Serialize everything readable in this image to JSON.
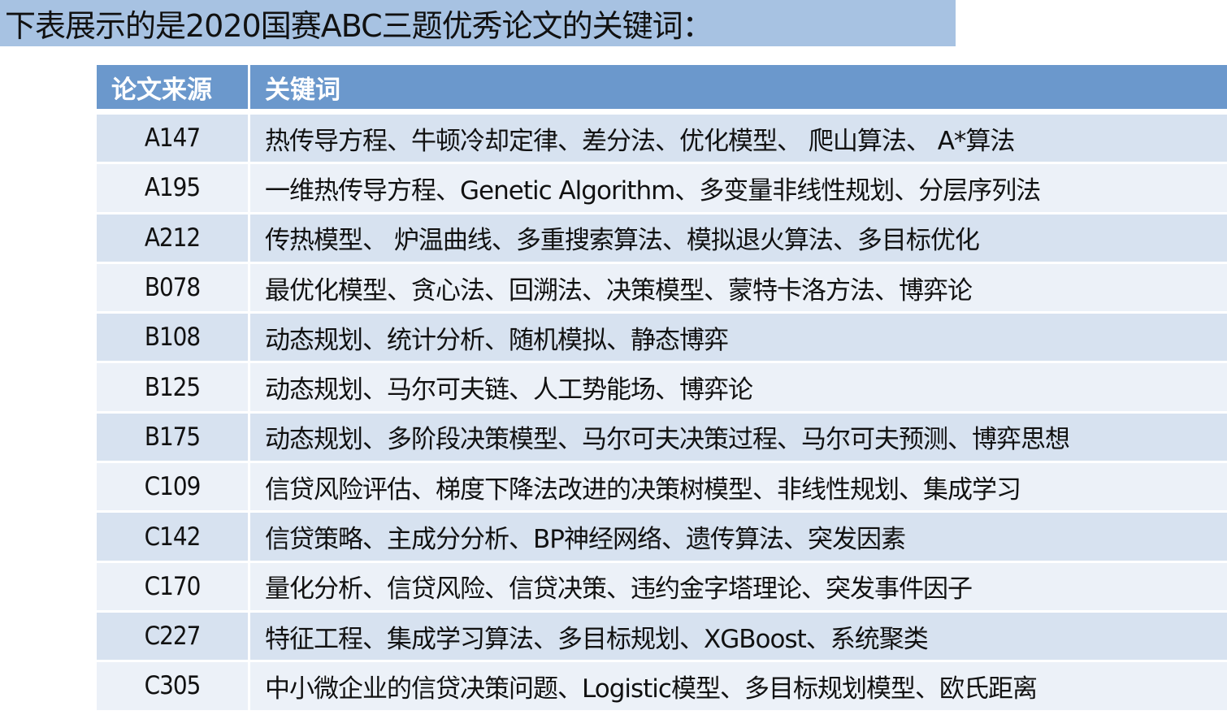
{
  "title": "下表展示的是2020国赛ABC三题优秀论文的关键词：",
  "table": {
    "headers": [
      "论文来源",
      "关键词"
    ],
    "rows": [
      [
        "A147",
        "热传导方程、牛顿冷却定律、差分法、优化模型、 爬山算法、 A*算法"
      ],
      [
        "A195",
        "一维热传导方程、Genetic Algorithm、多变量非线性规划、分层序列法"
      ],
      [
        "A212",
        "传热模型、 炉温曲线、多重搜索算法、模拟退火算法、多目标优化"
      ],
      [
        "B078",
        "最优化模型、贪心法、回溯法、决策模型、蒙特卡洛方法、博弈论"
      ],
      [
        "B108",
        "动态规划、统计分析、随机模拟、静态博弈"
      ],
      [
        "B125",
        "动态规划、马尔可夫链、人工势能场、博弈论"
      ],
      [
        "B175",
        "动态规划、多阶段决策模型、马尔可夫决策过程、马尔可夫预测、博弈思想"
      ],
      [
        "C109",
        "信贷风险评估、梯度下降法改进的决策树模型、非线性规划、集成学习"
      ],
      [
        "C142",
        "信贷策略、主成分分析、BP神经网络、遗传算法、突发因素"
      ],
      [
        "C170",
        "量化分析、信贷风险、信贷决策、违约金字塔理论、突发事件因子"
      ],
      [
        "C227",
        "特征工程、集成学习算法、多目标规划、XGBoost、系统聚类"
      ],
      [
        "C305",
        "中小微企业的信贷决策问题、Logistic模型、多目标规划模型、欧氏距离"
      ]
    ]
  },
  "colors": {
    "title_bg": "#a7c2e2",
    "header_bg": "#6b98cc",
    "row_odd": "#d7e2f0",
    "row_even": "#ecf1f8"
  }
}
